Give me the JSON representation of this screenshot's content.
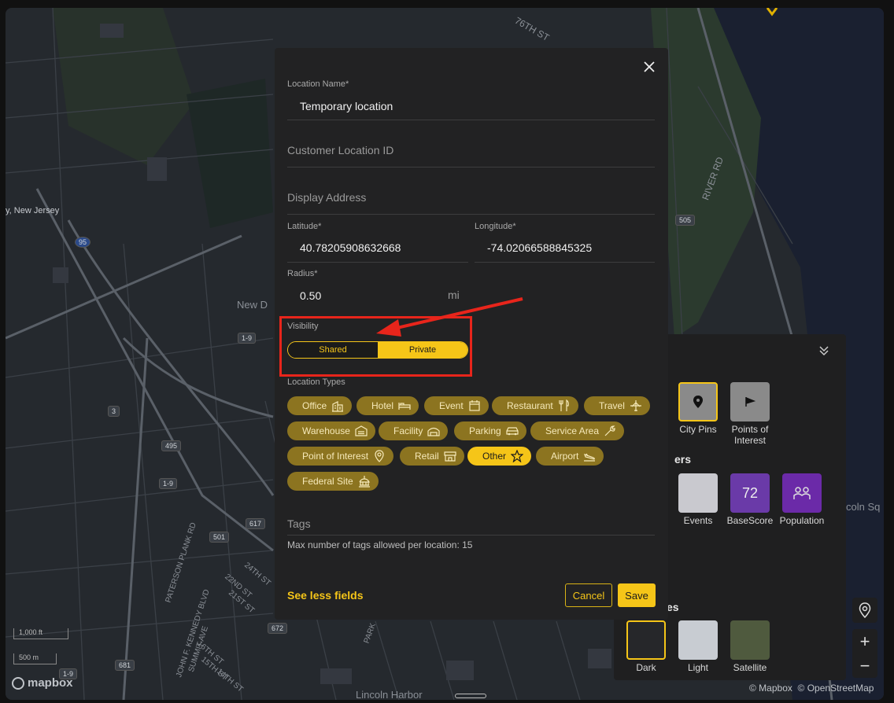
{
  "modal": {
    "close_icon": "close-icon",
    "location_name_label": "Location Name",
    "location_name_value": "Temporary location",
    "customer_location_id_placeholder": "Customer Location ID",
    "display_address_placeholder": "Display Address",
    "latitude_label": "Latitude",
    "latitude_value": "40.78205908632668",
    "longitude_label": "Longitude",
    "longitude_value": "-74.02066588845325",
    "radius_label": "Radius",
    "radius_value": "0.50",
    "radius_unit": "mi",
    "required_marker": "*",
    "visibility_label": "Visibility",
    "visibility_options": [
      "Shared",
      "Private"
    ],
    "visibility_selected": "Private",
    "location_types_label": "Location Types",
    "location_types": [
      {
        "label": "Office",
        "icon": "building-icon",
        "selected": false
      },
      {
        "label": "Hotel",
        "icon": "bed-icon",
        "selected": false
      },
      {
        "label": "Event",
        "icon": "calendar-icon",
        "selected": false
      },
      {
        "label": "Restaurant",
        "icon": "utensils-icon",
        "selected": false
      },
      {
        "label": "Travel",
        "icon": "airplane-icon",
        "selected": false
      },
      {
        "label": "Warehouse",
        "icon": "warehouse-icon",
        "selected": false
      },
      {
        "label": "Facility",
        "icon": "facility-icon",
        "selected": false
      },
      {
        "label": "Parking",
        "icon": "car-icon",
        "selected": false
      },
      {
        "label": "Service Area",
        "icon": "wrench-icon",
        "selected": false
      },
      {
        "label": "Point of Interest",
        "icon": "map-pin-icon",
        "selected": false
      },
      {
        "label": "Retail",
        "icon": "store-icon",
        "selected": false
      },
      {
        "label": "Other",
        "icon": "star-icon",
        "selected": true
      },
      {
        "label": "Airport",
        "icon": "plane-landing-icon",
        "selected": false
      },
      {
        "label": "Federal Site",
        "icon": "capitol-icon",
        "selected": false
      }
    ],
    "tags_placeholder": "Tags",
    "tags_help": "Max number of tags allowed per location: 15",
    "see_less_fields": "See less fields",
    "cancel_label": "Cancel",
    "save_label": "Save",
    "accent_color": "#f5c518"
  },
  "layer_panel": {
    "collapse_icon": "chevrons-down-icon",
    "pins": [
      {
        "label": "City Pins",
        "icon": "map-pin-icon",
        "selected": true
      },
      {
        "label": "Points of Interest",
        "icon": "flag-icon",
        "selected": false
      }
    ],
    "layers_heading_partial": "ers",
    "layers": [
      {
        "label": "Events"
      },
      {
        "label": "BaseScore",
        "value": "72"
      },
      {
        "label": "Population"
      }
    ],
    "styles_heading_partial": "es",
    "styles": [
      {
        "label": "Dark",
        "selected": true
      },
      {
        "label": "Light",
        "selected": false
      },
      {
        "label": "Satellite",
        "selected": false
      }
    ]
  },
  "map": {
    "labels": [
      "76TH ST",
      "RIVER RD",
      "New Jersey",
      "New D",
      "PATERSON PLANK RD",
      "JOHN F. KENNEDY BLVD",
      "SUMMIT AVE",
      "Lincoln Harbor",
      "24TH ST",
      "22ND ST",
      "21ST ST",
      "16TH ST",
      "15TH ST",
      "14TH ST",
      "PARK",
      "coln Sq"
    ],
    "shields": [
      "95",
      "1-9",
      "3",
      "495",
      "1-9",
      "617",
      "501",
      "672",
      "681",
      "1-9",
      "505"
    ],
    "scale": [
      "1,000 ft",
      "500 m"
    ],
    "brand": "mapbox",
    "attribution": "© Mapbox  © OpenStreetMap"
  }
}
